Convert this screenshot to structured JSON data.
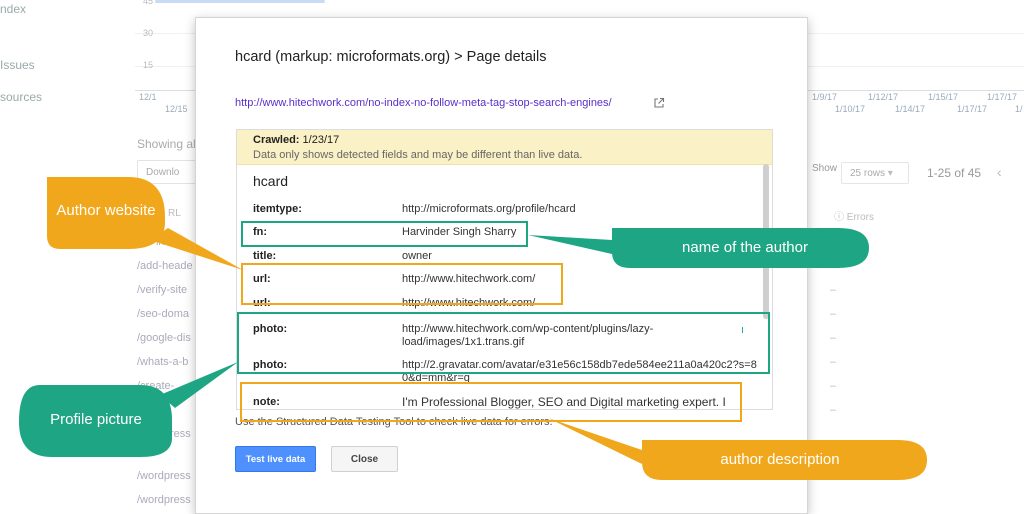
{
  "background": {
    "sidebar": [
      "ndex",
      "Issues",
      "sources"
    ],
    "graph": {
      "yticks": [
        "45",
        "30",
        "15"
      ],
      "xticks_top": [
        "12/1",
        "1/9/17",
        "1/12/17",
        "1/15/17",
        "1/17/17"
      ],
      "xticks_bottom": [
        "12/15",
        "1/10/17",
        "1/14/17",
        "1/17/17",
        "1/"
      ]
    },
    "showing": "Showing al",
    "download": "Downlo",
    "url_header": "RL",
    "rows": [
      "/no-index",
      "/add-heade",
      "/verify-site",
      "/seo-doma",
      "/google-dis",
      "/whats-a-b",
      "/create-",
      "/",
      "/wordpress",
      "/wordpress",
      "/wordpress"
    ],
    "show_label": "Show",
    "rows_select": "25 rows",
    "count": "1-25 of 45",
    "prev_icon": "chevron-left-icon",
    "errors_header": "Errors",
    "dash": "–"
  },
  "dialog": {
    "title": "hcard (markup: microformats.org) > Page details",
    "link": "http://www.hitechwork.com/no-index-no-follow-meta-tag-stop-search-engines/",
    "crawled_label": "Crawled:",
    "crawled_date": "1/23/17",
    "crawl_note": "Data only shows detected fields and may be different than live data.",
    "section_title": "hcard",
    "properties": [
      {
        "name": "itemtype:",
        "value": "http://microformats.org/profile/hcard"
      },
      {
        "name": "fn:",
        "value": "Harvinder Singh Sharry"
      },
      {
        "name": "title:",
        "value": "owner"
      },
      {
        "name": "url:",
        "value": "http://www.hitechwork.com/"
      },
      {
        "name": "url:",
        "value": "http://www.hitechwork.com/"
      },
      {
        "name": "photo:",
        "value": "http://www.hitechwork.com/wp-content/plugins/lazy-load/images/1x1.trans.gif"
      },
      {
        "name": "photo:",
        "value": "http://2.gravatar.com/avatar/e31e56c158db7ede584ee211a0a420c2?s=80&d=mm&r=g"
      },
      {
        "name": "note:",
        "value": "I'm Professional Blogger, SEO and Digital marketing expert. I"
      }
    ],
    "footnote": "Use the Structured Data Testing Tool to check live data for errors.",
    "test_button": "Test live data",
    "close_button": "Close"
  },
  "annotations": {
    "author_website": "Author website",
    "name_of_author": "name of the author",
    "profile_picture": "Profile picture",
    "author_description": "author description",
    "colors": {
      "green": "#1ea584",
      "orange": "#f1a71b"
    }
  }
}
